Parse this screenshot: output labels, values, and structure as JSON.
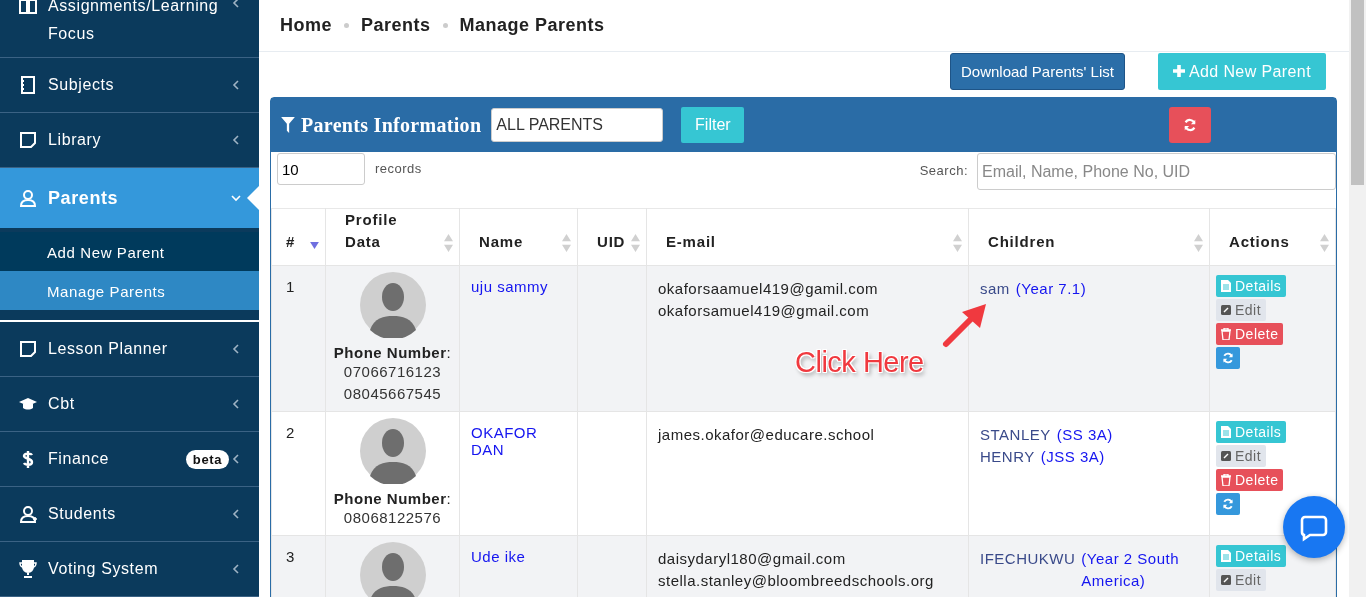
{
  "sidebar": {
    "items": [
      {
        "label": "Assignments/Learning Focus",
        "expanded": false,
        "selected": false
      },
      {
        "label": "Subjects",
        "expanded": false,
        "selected": false
      },
      {
        "label": "Library",
        "expanded": false,
        "selected": false
      },
      {
        "label": "Parents",
        "expanded": true,
        "selected": true,
        "children": [
          {
            "label": "Add New Parent",
            "selected": false
          },
          {
            "label": "Manage Parents",
            "selected": true
          }
        ]
      },
      {
        "label": "Lesson Planner",
        "expanded": false,
        "selected": false
      },
      {
        "label": "Cbt",
        "expanded": false,
        "selected": false
      },
      {
        "label": "Finance",
        "expanded": false,
        "selected": false,
        "badge": "beta"
      },
      {
        "label": "Students",
        "expanded": false,
        "selected": false
      },
      {
        "label": "Voting System",
        "expanded": false,
        "selected": false
      }
    ]
  },
  "breadcrumb": [
    "Home",
    "Parents",
    "Manage Parents"
  ],
  "buttons": [
    {
      "label": "Download Parents' List",
      "kind": "primary"
    },
    {
      "label": "Add New Parent",
      "kind": "add"
    }
  ],
  "panel": {
    "title": "Parents Information",
    "filter_value": "ALL PARENTS",
    "filter_button": "Filter",
    "page_length": "10",
    "page_length_label": "records",
    "search_label": "Search:",
    "search_placeholder": "Email, Name, Phone No, UID"
  },
  "table": {
    "columns": [
      {
        "label": "#",
        "sorted": true
      },
      {
        "label": "Profile Data",
        "sorted": false
      },
      {
        "label": "Name",
        "sorted": false
      },
      {
        "label": "UID",
        "sorted": false
      },
      {
        "label": "E-mail",
        "sorted": false
      },
      {
        "label": "Children",
        "sorted": false
      },
      {
        "label": "Actions",
        "sorted": false
      }
    ],
    "rows": [
      {
        "number": "1",
        "phone_label": "**Phone Number**:",
        "phones": [
          "07066716123",
          "08045667545"
        ],
        "name": "uju sammy",
        "emails": [
          "okaforsaamuel419@gamil.com",
          "okaforsamuel419@gmail.com"
        ],
        "children": [
          {
            "name": "sam",
            "class": "(Year 7.1)"
          }
        ],
        "actions": [
          "Details",
          "Edit",
          "Delete"
        ]
      },
      {
        "number": "2",
        "phone_label": "**Phone Number**:",
        "phones": [
          "08068122576"
        ],
        "name": "OKAFOR DAN",
        "emails": [
          "james.okafor@educare.school"
        ],
        "children": [
          {
            "name": "STANLEY",
            "class": "(SS 3A)"
          },
          {
            "name": "HENRY",
            "class": "(JSS 3A)"
          }
        ],
        "actions": [
          "Details",
          "Edit",
          "Delete"
        ]
      },
      {
        "number": "3",
        "name": "Ude ike",
        "emails": [
          "daisydaryl180@gmail.com",
          "stella.stanley@bloombreedschools.org"
        ],
        "children": [
          {
            "name": "IFECHUKWU",
            "class": "(Year 2 South America)"
          }
        ],
        "actions": [
          "Details",
          "Edit"
        ]
      }
    ]
  },
  "annotation": "Click Here"
}
